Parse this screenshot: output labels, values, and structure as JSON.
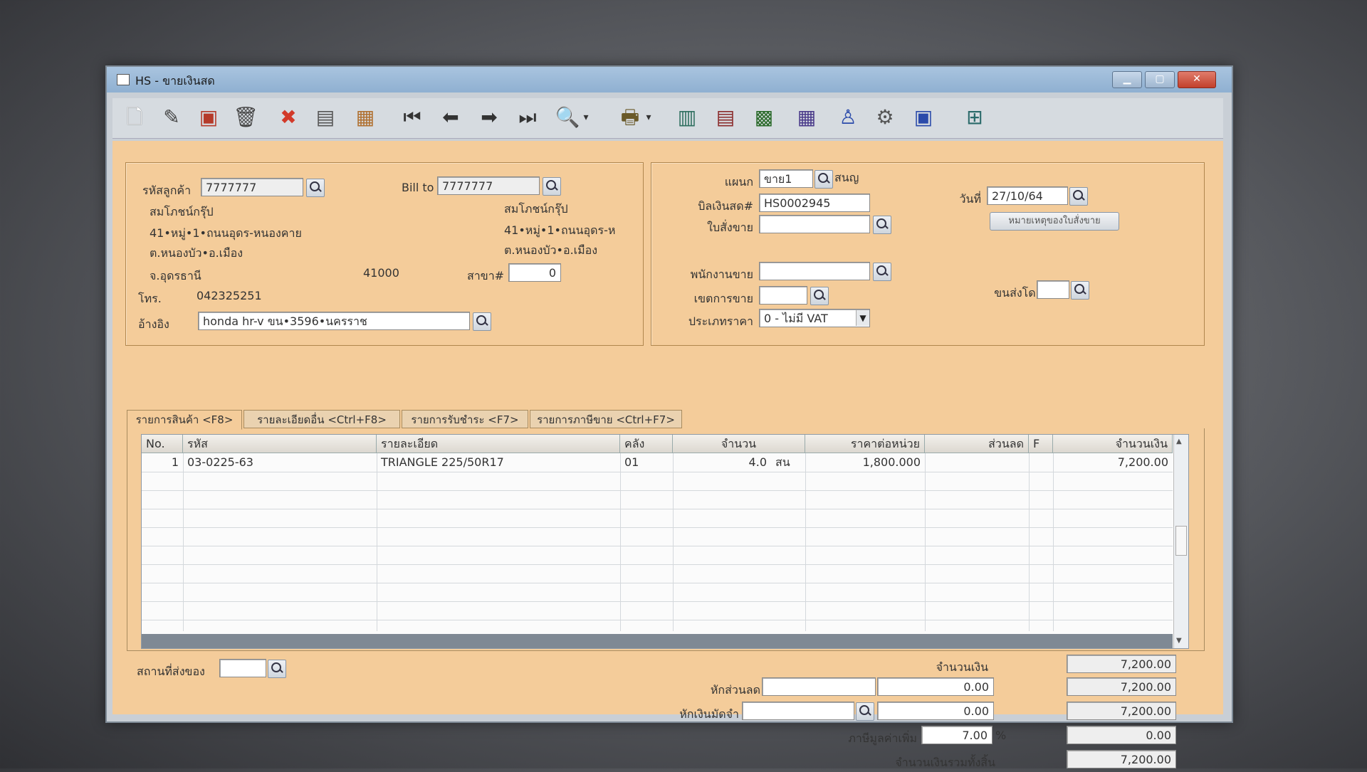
{
  "window": {
    "title": "HS - ขายเงินสด"
  },
  "customer": {
    "code_label": "รหัสลูกค้า",
    "code": "7777777",
    "name": "สมโภชน์กรุ๊ป",
    "address1": "41•หมู่•1•ถนนอุดร-หนองคาย",
    "address2": "ต.หนองบัว•อ.เมือง",
    "province": "จ.อุดรธานี",
    "zip": "41000",
    "branch_label": "สาขา#",
    "branch": "0",
    "phone_label": "โทร.",
    "phone": "042325251",
    "ref_label": "อ้างอิง",
    "ref": "honda hr-v ขน•3596•นครราช"
  },
  "billto": {
    "label": "Bill to",
    "code": "7777777",
    "name": "สมโภชน์กรุ๊ป",
    "address1": "41•หมู่•1•ถนนอุดร-ห",
    "address2": "ต.หนองบัว•อ.เมือง"
  },
  "doc": {
    "dept_label": "แผนก",
    "dept": "ขาย1",
    "dept_name": "สนญ",
    "bill_label": "บิลเงินสด#",
    "bill": "HS0002945",
    "order_label": "ใบสั่งขาย",
    "order": "",
    "date_label": "วันที่",
    "date": "27/10/64",
    "note_button": "หมายเหตุของใบสั่งขาย",
    "salesman_label": "พนักงานขาย",
    "salesman": "",
    "area_label": "เขตการขาย",
    "area": "",
    "price_type_label": "ประเภทราคา",
    "price_type": "0 - ไม่มี VAT",
    "ship_by_label": "ขนส่งโดย",
    "ship_by": ""
  },
  "tabs": [
    {
      "label": "รายการสินค้า <F8>"
    },
    {
      "label": "รายละเอียดอื่น <Ctrl+F8>"
    },
    {
      "label": "รายการรับชำระ <F7>"
    },
    {
      "label": "รายการภาษีขาย <Ctrl+F7>"
    }
  ],
  "grid": {
    "headers": [
      "No.",
      "รหัส",
      "รายละเอียด",
      "คลัง",
      "จำนวน",
      "ราคาต่อหน่วย",
      "ส่วนลด",
      "F",
      "จำนวนเงิน"
    ],
    "rows": [
      {
        "no": "1",
        "code": "03-0225-63",
        "desc": "TRIANGLE 225/50R17",
        "wh": "01",
        "qty": "4.0",
        "unit": "สน",
        "price": "1,800.000",
        "disc": "",
        "f": "",
        "amount": "7,200.00"
      }
    ]
  },
  "footer": {
    "ship_place_label": "สถานที่ส่งของ",
    "ship_place": "",
    "amount_label": "จำนวนเงิน",
    "amount": "7,200.00",
    "discount_label": "หักส่วนลด",
    "discount_text": "",
    "discount_value": "0.00",
    "after_discount": "7,200.00",
    "deposit_label": "หักเงินมัดจำ",
    "deposit_text": "",
    "deposit_value": "0.00",
    "after_deposit": "7,200.00",
    "vat_label": "ภาษีมูลค่าเพิ่ม",
    "vat_rate": "7.00",
    "vat_pct": "%",
    "vat_amount": "0.00",
    "total_label": "จำนวนเงินรวมทั้งสิ้น",
    "total": "7,200.00"
  },
  "window_buttons": {
    "minimize": "▁",
    "maximize": "▢",
    "close": "✕"
  }
}
